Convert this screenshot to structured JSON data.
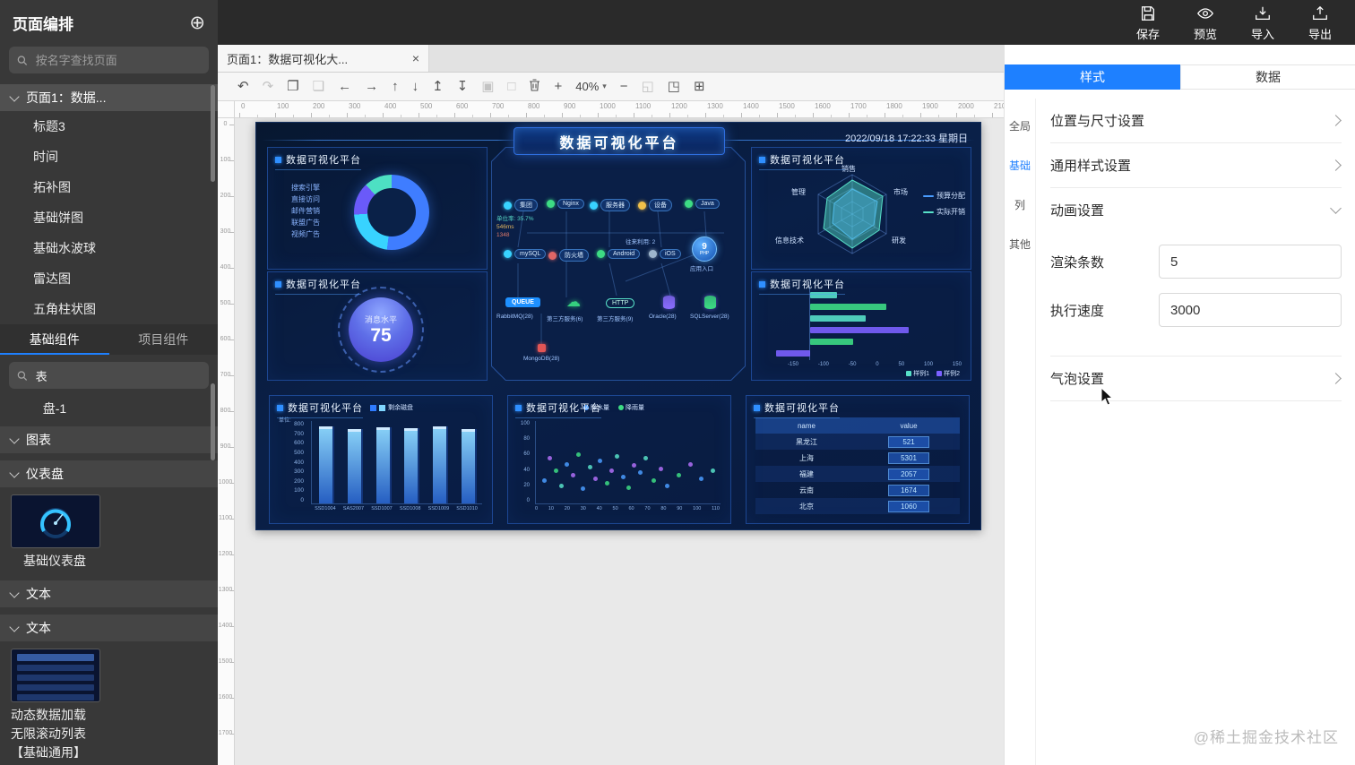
{
  "topbar": {
    "actions": [
      {
        "name": "save",
        "label": "保存"
      },
      {
        "name": "preview",
        "label": "预览"
      },
      {
        "name": "import",
        "label": "导入"
      },
      {
        "name": "export",
        "label": "导出"
      }
    ]
  },
  "sidebar": {
    "title": "页面编排",
    "add_icon": "⊕",
    "page_search_placeholder": "按名字查找页面",
    "selected_page": "页面1：数据...",
    "page_children": [
      "标题3",
      "时间",
      "拓补图",
      "基础饼图",
      "基础水波球",
      "雷达图",
      "五角柱状图"
    ],
    "component_tabs": [
      {
        "label": "基础组件",
        "active": true
      },
      {
        "label": "项目组件",
        "active": false
      }
    ],
    "component_search_value": "表",
    "partial_item": "盘-1",
    "section_chart": "图表",
    "section_gauge": "仪表盘",
    "gauge_item": "基础仪表盘",
    "section_text1": "文本",
    "section_text2": "文本",
    "text_item_lines": [
      "动态数据加载",
      "无限滚动列表",
      "【基础通用】"
    ]
  },
  "canvas": {
    "tab": {
      "label": "页面1：数据可视化大...",
      "close_icon": "×"
    },
    "toolbar": [
      {
        "name": "undo",
        "glyph": "↶"
      },
      {
        "name": "redo",
        "glyph": "↷",
        "disabled": true
      },
      {
        "name": "copy",
        "glyph": "❐"
      },
      {
        "name": "paste",
        "glyph": "❏",
        "disabled": true
      },
      {
        "name": "move-left",
        "glyph": "←"
      },
      {
        "name": "move-right",
        "glyph": "→"
      },
      {
        "name": "move-up",
        "glyph": "↑"
      },
      {
        "name": "move-down",
        "glyph": "↓"
      },
      {
        "name": "align-top",
        "glyph": "↥"
      },
      {
        "name": "align-bottom",
        "glyph": "↧"
      },
      {
        "name": "group",
        "glyph": "▣",
        "disabled": true
      },
      {
        "name": "ungroup",
        "glyph": "□",
        "disabled": true
      },
      {
        "name": "delete",
        "type": "trash"
      },
      {
        "name": "zoom-in",
        "glyph": "+"
      },
      {
        "name": "zoom-level",
        "type": "zoom",
        "value": "40%",
        "caret": "▾"
      },
      {
        "name": "zoom-out",
        "glyph": "−"
      },
      {
        "name": "zoom-fit",
        "glyph": "◱",
        "disabled": true
      },
      {
        "name": "fullscreen",
        "glyph": "◳"
      },
      {
        "name": "grid-view",
        "glyph": "⊞"
      }
    ],
    "ruler": {
      "h_max": 2100,
      "v_max": 1700,
      "step": 100
    }
  },
  "dashboard": {
    "title": "数据可视化平台",
    "datetime": "2022/09/18 17:22:33 星期日",
    "panel_title": "数据可视化平台",
    "donut": {
      "legend": [
        "搜索引擎",
        "直接访问",
        "邮件营销",
        "联盟广告",
        "视频广告"
      ],
      "segments": [
        {
          "c": "#3f7dff",
          "p": 52
        },
        {
          "c": "#38d3ff",
          "p": 22
        },
        {
          "c": "#6a5af9",
          "p": 14
        },
        {
          "c": "#4de0c3",
          "p": 12
        }
      ]
    },
    "water": {
      "label": "消息水平",
      "value": "75"
    },
    "topology": {
      "row1": [
        {
          "label": "集团",
          "c": "#38d3ff"
        },
        {
          "label": "Nginx",
          "c": "#3ddc84"
        },
        {
          "label": "服务器",
          "c": "#38d3ff"
        },
        {
          "label": "设备",
          "c": "#f0c04a"
        },
        {
          "label": "Java",
          "c": "#3ddc84"
        }
      ],
      "stats": [
        {
          "t": "单位率: 35.7%",
          "c": "#57d7c5"
        },
        {
          "t": "546ms",
          "c": "#e2b55e"
        },
        {
          "t": "1348",
          "c": "#e07a6a"
        }
      ],
      "stats2": "往来利用: 2",
      "row2": [
        {
          "label": "mySQL",
          "c": "#38d3ff"
        },
        {
          "label": "防火墙",
          "c": "#e06666"
        },
        {
          "label": "Android",
          "c": "#3ddc84"
        },
        {
          "label": "iOS",
          "c": "#9fb6cc"
        }
      ],
      "entry": {
        "value": "9",
        "sub": "PHP",
        "label": "应用入口"
      },
      "row3": [
        {
          "type": "queue",
          "label": "QUEUE",
          "sub": "RabbitMQ(28)"
        },
        {
          "type": "cloud",
          "glyph": "☁",
          "sub": "第三方服务(6)"
        },
        {
          "type": "http",
          "label": "HTTP",
          "sub": "第三方服务(9)"
        },
        {
          "type": "db",
          "c": "#8a6cff",
          "sub": "Oracle(28)"
        },
        {
          "type": "db",
          "c": "#3ddc84",
          "sub": "SQLServer(28)"
        }
      ],
      "bottom": {
        "sub": "MongoDB(28)"
      }
    },
    "radar": {
      "axes": [
        "销售",
        "市场",
        "研发",
        "信息技术",
        "管理"
      ],
      "legend": [
        {
          "label": "预算分配",
          "c": "#4a9cff"
        },
        {
          "label": "实际开销",
          "c": "#57e0c8"
        }
      ]
    },
    "hbar": {
      "bars": [
        {
          "v": 30,
          "c": "#57e0c8"
        },
        {
          "v": 85,
          "c": "#3ddc84"
        },
        {
          "v": 62,
          "c": "#57e0c8"
        },
        {
          "v": 110,
          "c": "#7b61ff"
        },
        {
          "v": 48,
          "c": "#3ddc84"
        },
        {
          "v": -38,
          "c": "#7b61ff"
        }
      ],
      "xticks": [
        "-150",
        "-100",
        "-50",
        "0",
        "50",
        "100",
        "150"
      ],
      "legend": [
        {
          "label": "样例1",
          "c": "#57e0c8"
        },
        {
          "label": "样例2",
          "c": "#7b61ff"
        }
      ]
    },
    "bar3d": {
      "legend": "剩余磁盘",
      "unit_label": "单位:",
      "yticks": [
        "800",
        "700",
        "600",
        "500",
        "400",
        "300",
        "200",
        "100",
        "0"
      ],
      "categories": [
        "SSD1004",
        "SAS2007",
        "SSD1007",
        "SSD1008",
        "SSD1009",
        "SSD1010"
      ],
      "values": [
        720,
        700,
        712,
        705,
        718,
        698
      ],
      "ymax": 800
    },
    "scatter": {
      "legend": [
        {
          "label": "降水量",
          "c": "#4a9cff"
        },
        {
          "label": "降雨量",
          "c": "#3ddc84"
        }
      ],
      "yticks": [
        "100",
        "80",
        "60",
        "40",
        "20",
        "0"
      ],
      "xticks": [
        "0",
        "10",
        "20",
        "30",
        "40",
        "50",
        "60",
        "70",
        "80",
        "90",
        "100",
        "110"
      ],
      "points": [
        [
          5,
          28,
          0
        ],
        [
          8,
          55,
          2
        ],
        [
          12,
          40,
          1
        ],
        [
          15,
          22,
          3
        ],
        [
          18,
          48,
          0
        ],
        [
          22,
          35,
          2
        ],
        [
          25,
          60,
          1
        ],
        [
          28,
          18,
          0
        ],
        [
          32,
          45,
          3
        ],
        [
          35,
          30,
          2
        ],
        [
          38,
          52,
          0
        ],
        [
          42,
          25,
          1
        ],
        [
          45,
          40,
          2
        ],
        [
          48,
          58,
          3
        ],
        [
          52,
          33,
          0
        ],
        [
          55,
          20,
          1
        ],
        [
          58,
          47,
          2
        ],
        [
          62,
          38,
          0
        ],
        [
          65,
          55,
          3
        ],
        [
          70,
          28,
          1
        ],
        [
          74,
          42,
          2
        ],
        [
          78,
          22,
          0
        ],
        [
          85,
          35,
          1
        ],
        [
          92,
          48,
          2
        ],
        [
          98,
          30,
          0
        ],
        [
          105,
          40,
          3
        ]
      ]
    },
    "table": {
      "columns": [
        "name",
        "value"
      ],
      "rows": [
        [
          "黑龙江",
          "521"
        ],
        [
          "上海",
          "5301"
        ],
        [
          "福建",
          "2057"
        ],
        [
          "云南",
          "1674"
        ],
        [
          "北京",
          "1060"
        ]
      ]
    }
  },
  "inspector": {
    "tabs": [
      {
        "label": "样式",
        "active": true
      },
      {
        "label": "数据",
        "active": false
      }
    ],
    "side_tabs": [
      {
        "label": "全局",
        "active": false
      },
      {
        "label": "基础",
        "active": true
      },
      {
        "label": "列",
        "active": false
      },
      {
        "label": "其他",
        "active": false
      }
    ],
    "rows": [
      {
        "label": "位置与尺寸设置"
      },
      {
        "label": "通用样式设置"
      },
      {
        "label": "动画设置"
      },
      {
        "label": "气泡设置"
      }
    ],
    "fields": [
      {
        "label": "渲染条数",
        "value": "5"
      },
      {
        "label": "执行速度",
        "value": "3000"
      }
    ]
  },
  "watermark": "@稀土掘金技术社区"
}
